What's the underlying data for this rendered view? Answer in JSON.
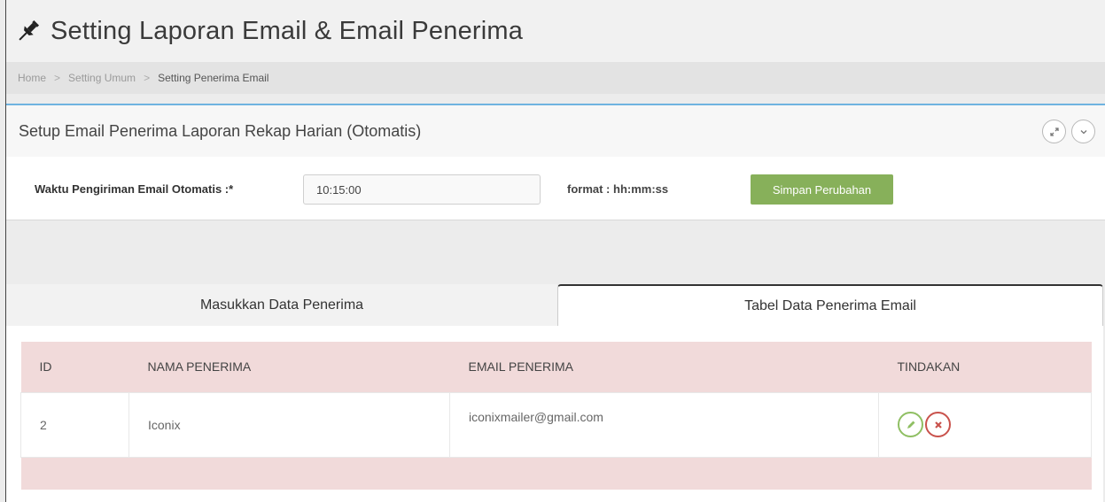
{
  "header": {
    "title": "Setting Laporan Email & Email Penerima",
    "icon": "pin-icon"
  },
  "breadcrumb": [
    "Home",
    "Setting Umum",
    "Setting Penerima Email"
  ],
  "panel": {
    "title": "Setup Email Penerima Laporan Rekap Harian (Otomatis)",
    "tools": [
      "expand-icon",
      "collapse-icon"
    ],
    "field_label": "Waktu Pengiriman Email Otomatis :*",
    "time_value": "10:15:00",
    "format_hint": "format : hh:mm:ss",
    "save_label": "Simpan Perubahan"
  },
  "tabs": [
    {
      "label": "Masukkan Data Penerima",
      "active": false
    },
    {
      "label": "Tabel Data Penerima Email",
      "active": true
    }
  ],
  "table": {
    "columns": [
      "ID",
      "NAMA PENERIMA",
      "EMAIL PENERIMA",
      "TINDAKAN"
    ],
    "rows": [
      {
        "id": "2",
        "nama": "Iconix",
        "email": "iconixmailer@gmail.com"
      }
    ]
  },
  "colors": {
    "accent_blue": "#6fb3e0",
    "save_green": "#87b05a",
    "table_header_pink": "#f1dada",
    "edit_green": "#8fbf63",
    "delete_red": "#c9524c"
  }
}
